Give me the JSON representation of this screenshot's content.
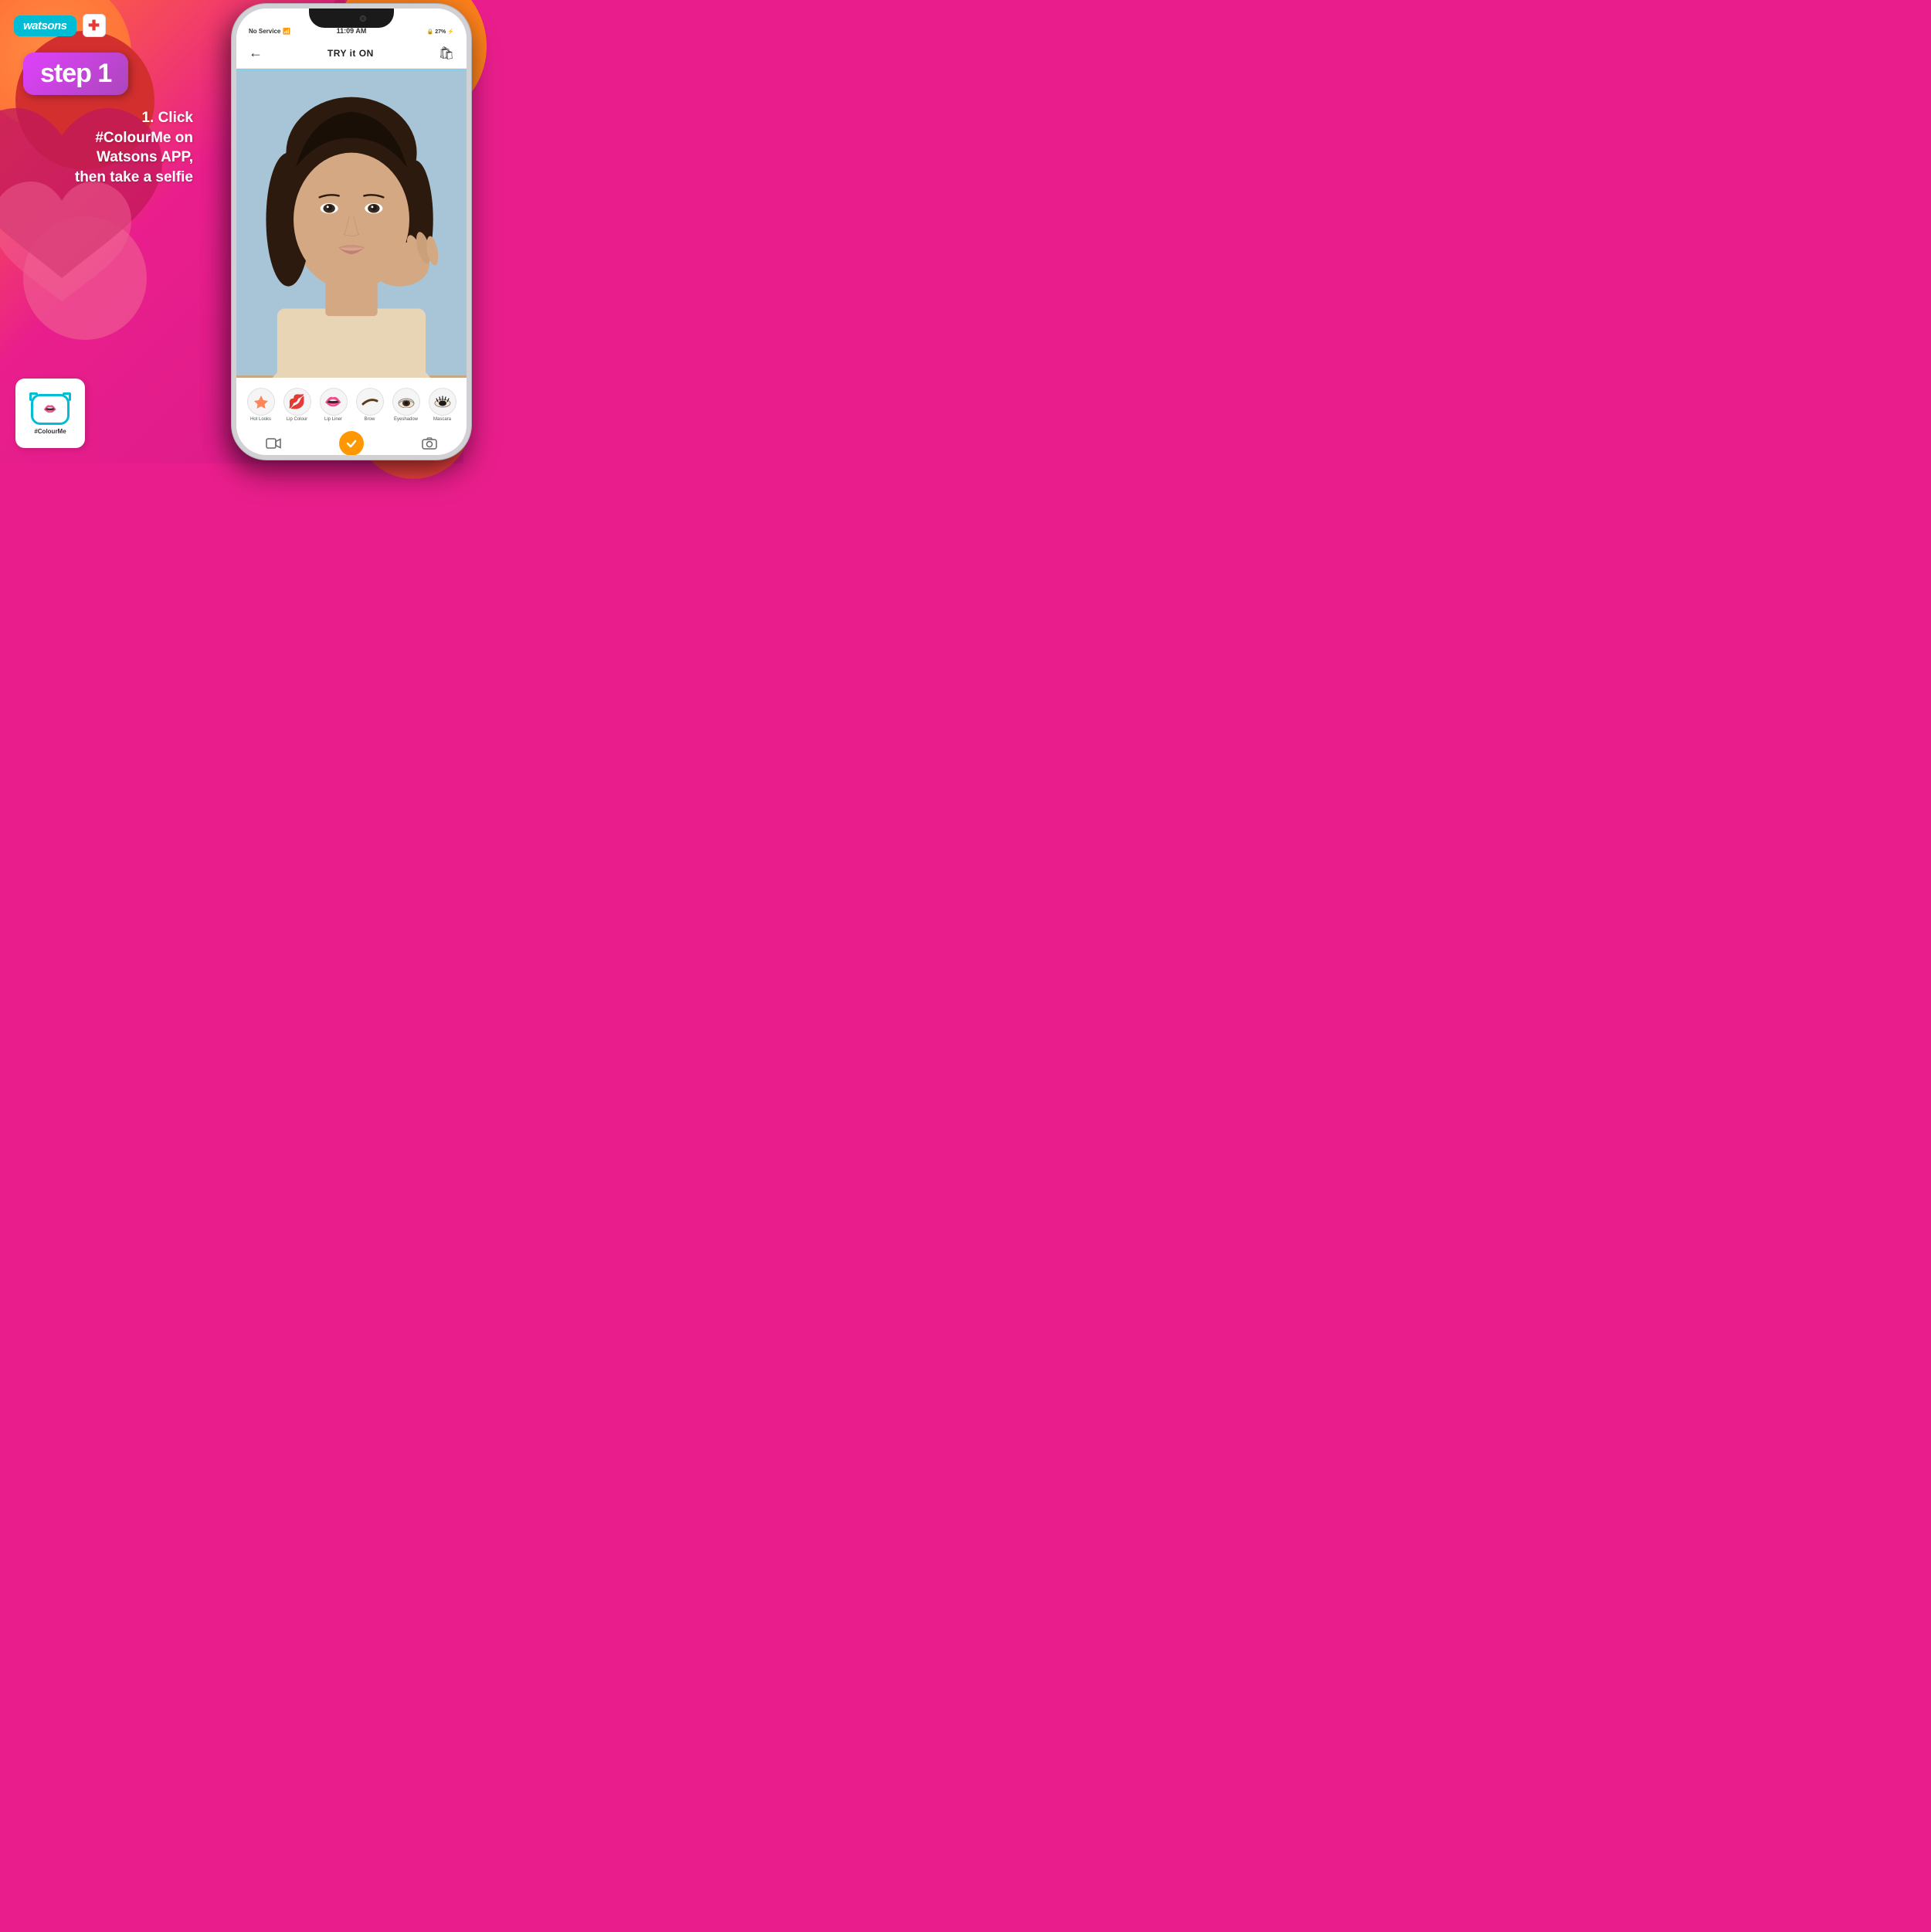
{
  "page": {
    "background_color": "#e91e8c",
    "title": "Watsons ColourMe Step 1"
  },
  "header": {
    "watsons_label": "watsons",
    "pharmacy_label": "Pharmacy",
    "watsons_bg_color": "#00bcd4"
  },
  "step": {
    "label": "step 1",
    "bg_color_start": "#e040fb",
    "bg_color_end": "#ab47bc"
  },
  "instructions": {
    "line1": "1.  Click",
    "line2": "#ColourMe on",
    "line3": "Watsons APP,",
    "line4": "then take a selfie",
    "full_text": "1.  Click #ColourMe on Watsons APP, then take a selfie"
  },
  "colour_me_logo": {
    "label": "#ColourMe"
  },
  "phone": {
    "status_bar": {
      "left": "No Service",
      "wifi_icon": "wifi",
      "time": "11:09 AM",
      "battery": "27%",
      "battery_charging": true
    },
    "app_header": {
      "back_icon": "←",
      "title": "TRY it ON",
      "cart_icon": "🛍"
    },
    "makeup_items": [
      {
        "label": "Hot Looks",
        "emoji": "✨"
      },
      {
        "label": "Lip Colour",
        "emoji": "💋"
      },
      {
        "label": "Lip Liner",
        "emoji": "👄"
      },
      {
        "label": "Brow",
        "emoji": "〰"
      },
      {
        "label": "Eyeshadow",
        "emoji": "👁"
      },
      {
        "label": "Mascara",
        "emoji": "👁"
      }
    ],
    "action_bar": {
      "video_icon": "📹",
      "check_icon": "✓",
      "camera_icon": "📷"
    }
  }
}
